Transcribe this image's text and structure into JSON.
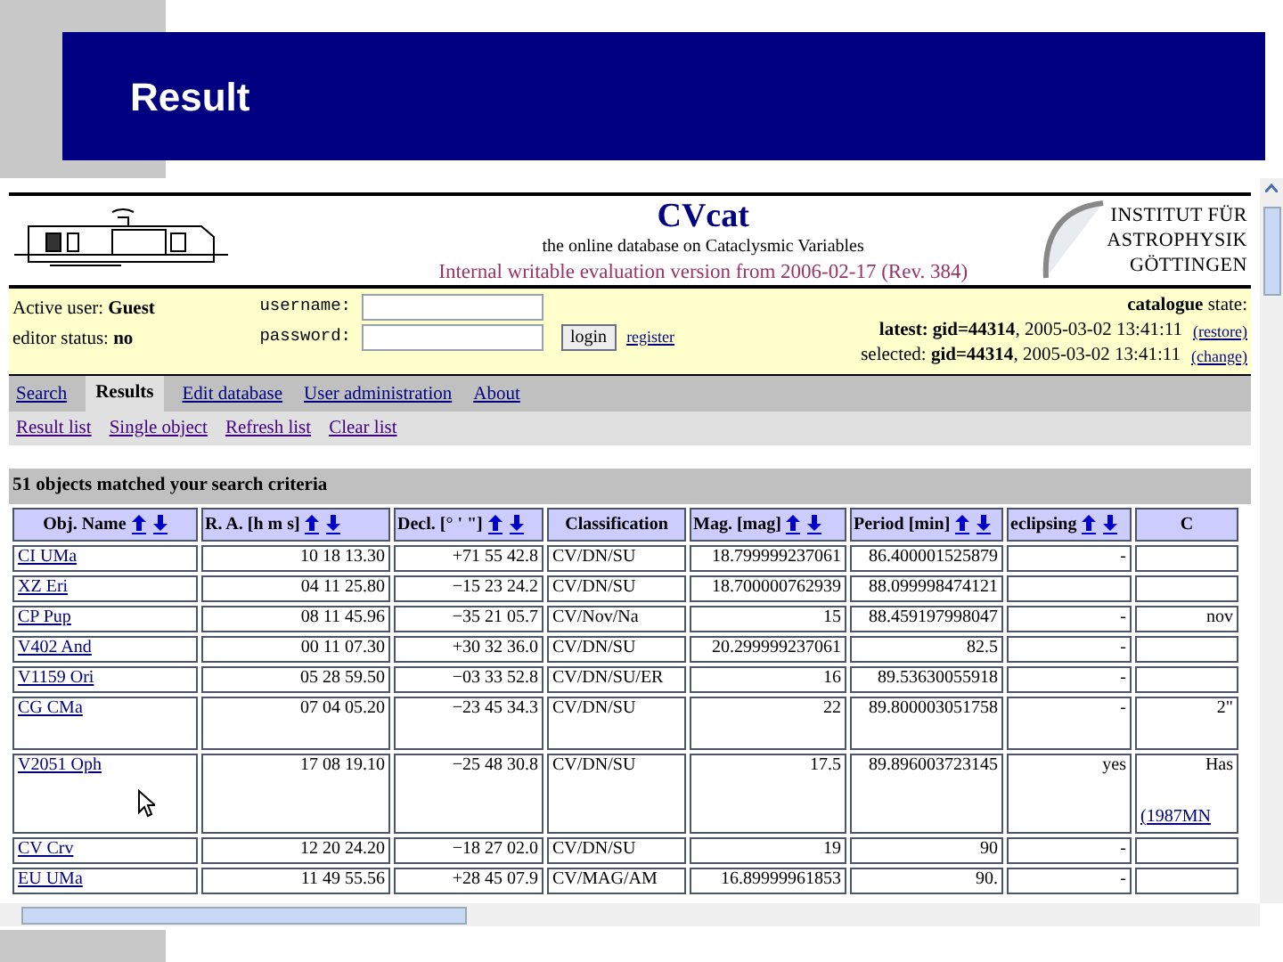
{
  "slide": {
    "title": "Result"
  },
  "site": {
    "title": "CVcat",
    "subtitle": "the online database on Cataclysmic Variables",
    "version_note": "Internal writable evaluation version from 2006-02-17 (Rev. 384)",
    "institute": [
      "INSTITUT FÜR",
      "ASTROPHYSIK",
      "GÖTTINGEN"
    ]
  },
  "user": {
    "active": "Active user: **Guest**",
    "status": "editor status: **no**"
  },
  "login": {
    "username_label": "username:",
    "password_label": "password:",
    "button": "login",
    "register_link": "register"
  },
  "catalogue": {
    "heading": "**catalogue** state:",
    "lines": [
      {
        "text": "**latest: gid=44314**, 2005-03-02 13:41:11",
        "link": "(restore)"
      },
      {
        "text": "selected: **gid=44314**, 2005-03-02 13:41:11",
        "link": "(change)"
      }
    ]
  },
  "tabs": [
    {
      "label": "Search",
      "selected": false
    },
    {
      "label": "Results",
      "selected": true
    },
    {
      "label": "Edit database",
      "selected": false
    },
    {
      "label": "User administration",
      "selected": false
    },
    {
      "label": "About",
      "selected": false
    }
  ],
  "subnav": [
    "Result list",
    "Single object",
    "Refresh list",
    "Clear list"
  ],
  "result_count": "51 objects matched your search criteria",
  "table": {
    "columns": [
      {
        "label": "Obj. Name",
        "sortable": true
      },
      {
        "label": "R. A. [h m s]",
        "sortable": true
      },
      {
        "label": "Decl. [° ' \"]",
        "sortable": true
      },
      {
        "label": "Classification",
        "sortable": false
      },
      {
        "label": "Mag. [mag]",
        "sortable": true
      },
      {
        "label": "Period [min]",
        "sortable": true
      },
      {
        "label": "eclipsing",
        "sortable": true
      },
      {
        "label": "C",
        "sortable": false
      }
    ],
    "rows": [
      {
        "name": "CI UMa",
        "ra": "10 18 13.30",
        "dec": "+71 55 42.8",
        "class": "CV/DN/SU",
        "mag": "18.799999237061",
        "period": "86.400001525879",
        "eclipsing": "-",
        "column_8": ""
      },
      {
        "name": "XZ Eri",
        "ra": "04 11 25.80",
        "dec": "−15 23 24.2",
        "class": "CV/DN/SU",
        "mag": "18.700000762939",
        "period": "88.099998474121",
        "eclipsing": "",
        "column_8": ""
      },
      {
        "name": "CP Pup",
        "ra": "08 11 45.96",
        "dec": "−35 21 05.7",
        "class": "CV/Nov/Na",
        "mag": "15",
        "period": "88.459197998047",
        "eclipsing": "-",
        "column_8": "nov"
      },
      {
        "name": "V402 And",
        "ra": "00 11 07.30",
        "dec": "+30 32 36.0",
        "class": "CV/DN/SU",
        "mag": "20.299999237061",
        "period": "82.5",
        "eclipsing": "-",
        "column_8": ""
      },
      {
        "name": "V1159 Ori",
        "ra": "05 28 59.50",
        "dec": "−03 33 52.8",
        "class": "CV/DN/SU/ER",
        "mag": "16",
        "period": "89.53630055918",
        "eclipsing": "-",
        "column_8": ""
      },
      {
        "name": "CG CMa",
        "ra": "07 04 05.20",
        "dec": "−23 45 34.3",
        "class": "CV/DN/SU",
        "mag": "22",
        "period": "89.800003051758",
        "eclipsing": "-",
        "column_8": "2\"",
        "kind": "double"
      },
      {
        "name": "V2051 Oph",
        "ra": "17 08 19.10",
        "dec": "−25 48 30.8",
        "class": "CV/DN/SU",
        "mag": "17.5",
        "period": "89.896003723145",
        "eclipsing": "yes",
        "column_8": "Has",
        "column_8_link": "(1987MN",
        "kind": "triple"
      },
      {
        "name": "CV Crv",
        "ra": "12 20 24.20",
        "dec": "−18 27 02.0",
        "class": "CV/DN/SU",
        "mag": "19",
        "period": "90",
        "eclipsing": "-",
        "column_8": ""
      },
      {
        "name": "EU UMa",
        "ra": "11 49 55.56",
        "dec": "+28 45 07.9",
        "class": "CV/MAG/AM",
        "mag": "16.89999961853",
        "period": "90.",
        "eclipsing": "-",
        "column_8": ""
      }
    ]
  }
}
